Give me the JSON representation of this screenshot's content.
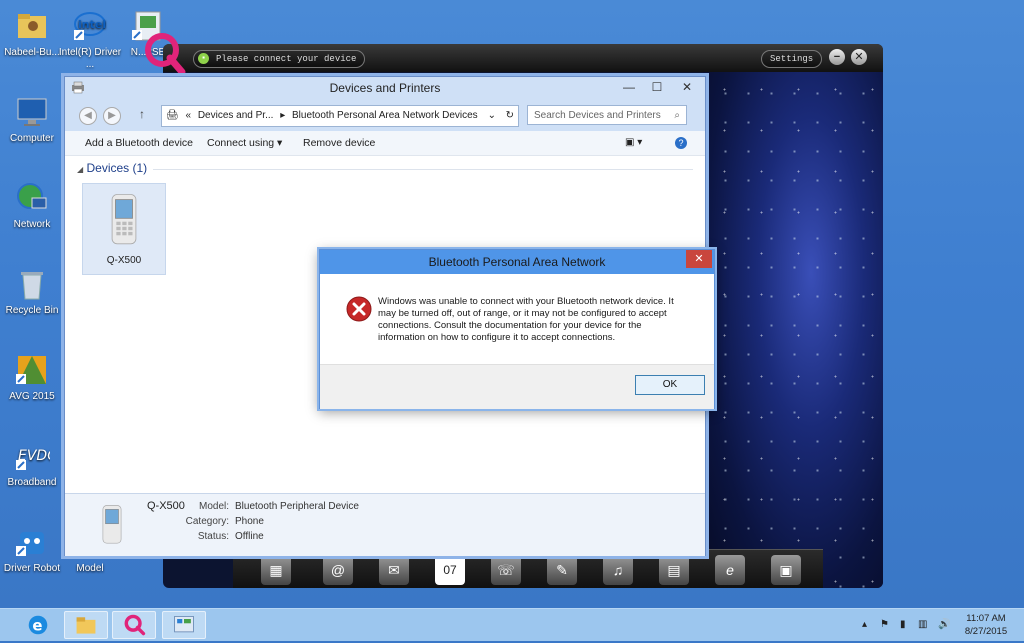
{
  "desktop": {
    "icons": [
      {
        "label": "Nabeel-Bu..."
      },
      {
        "label": "Intel(R) Driver ..."
      },
      {
        "label": "N...2SE"
      },
      {
        "label": "Computer"
      },
      {
        "label": "Network"
      },
      {
        "label": "Recycle Bin"
      },
      {
        "label": "AVG 2015"
      },
      {
        "label": "Broadband"
      },
      {
        "label": "Driver Robot"
      },
      {
        "label": "Model"
      }
    ]
  },
  "phone_manager": {
    "status": "Please connect your device",
    "settings_label": "Settings",
    "minimize": "−",
    "close": "✕",
    "dock_items": [
      "▦",
      "@",
      "✉",
      "07",
      "☏",
      "✎",
      "♫",
      "▤",
      "e",
      "▣"
    ]
  },
  "devices_window": {
    "title": "Devices and Printers",
    "minimize": "—",
    "maximize": "☐",
    "close": "✕",
    "breadcrumb_prefix": "«",
    "breadcrumb_1": "Devices and Pr...",
    "breadcrumb_sep": "▸",
    "breadcrumb_2": "Bluetooth Personal Area Network Devices",
    "search_placeholder": "Search Devices and Printers",
    "toolbar": {
      "add": "Add a Bluetooth device",
      "connect": "Connect using ▾",
      "remove": "Remove device"
    },
    "group_label": "Devices (1)",
    "device_name": "Q-X500",
    "details": {
      "name": "Q-X500",
      "model_key": "Model:",
      "model_val": "Bluetooth Peripheral Device",
      "category_key": "Category:",
      "category_val": "Phone",
      "status_key": "Status:",
      "status_val": "Offline"
    }
  },
  "dialog": {
    "title": "Bluetooth Personal Area Network",
    "close": "✕",
    "message": "Windows was unable to connect with your Bluetooth network device. It may be turned off, out of range, or it may not be configured to accept connections. Consult the documentation for your device for the information on how to configure it to accept connections.",
    "ok_label": "OK"
  },
  "taskbar": {
    "time": "11:07 AM",
    "date": "8/27/2015"
  },
  "colors": {
    "accent": "#4f95e8",
    "error": "#c62828"
  }
}
